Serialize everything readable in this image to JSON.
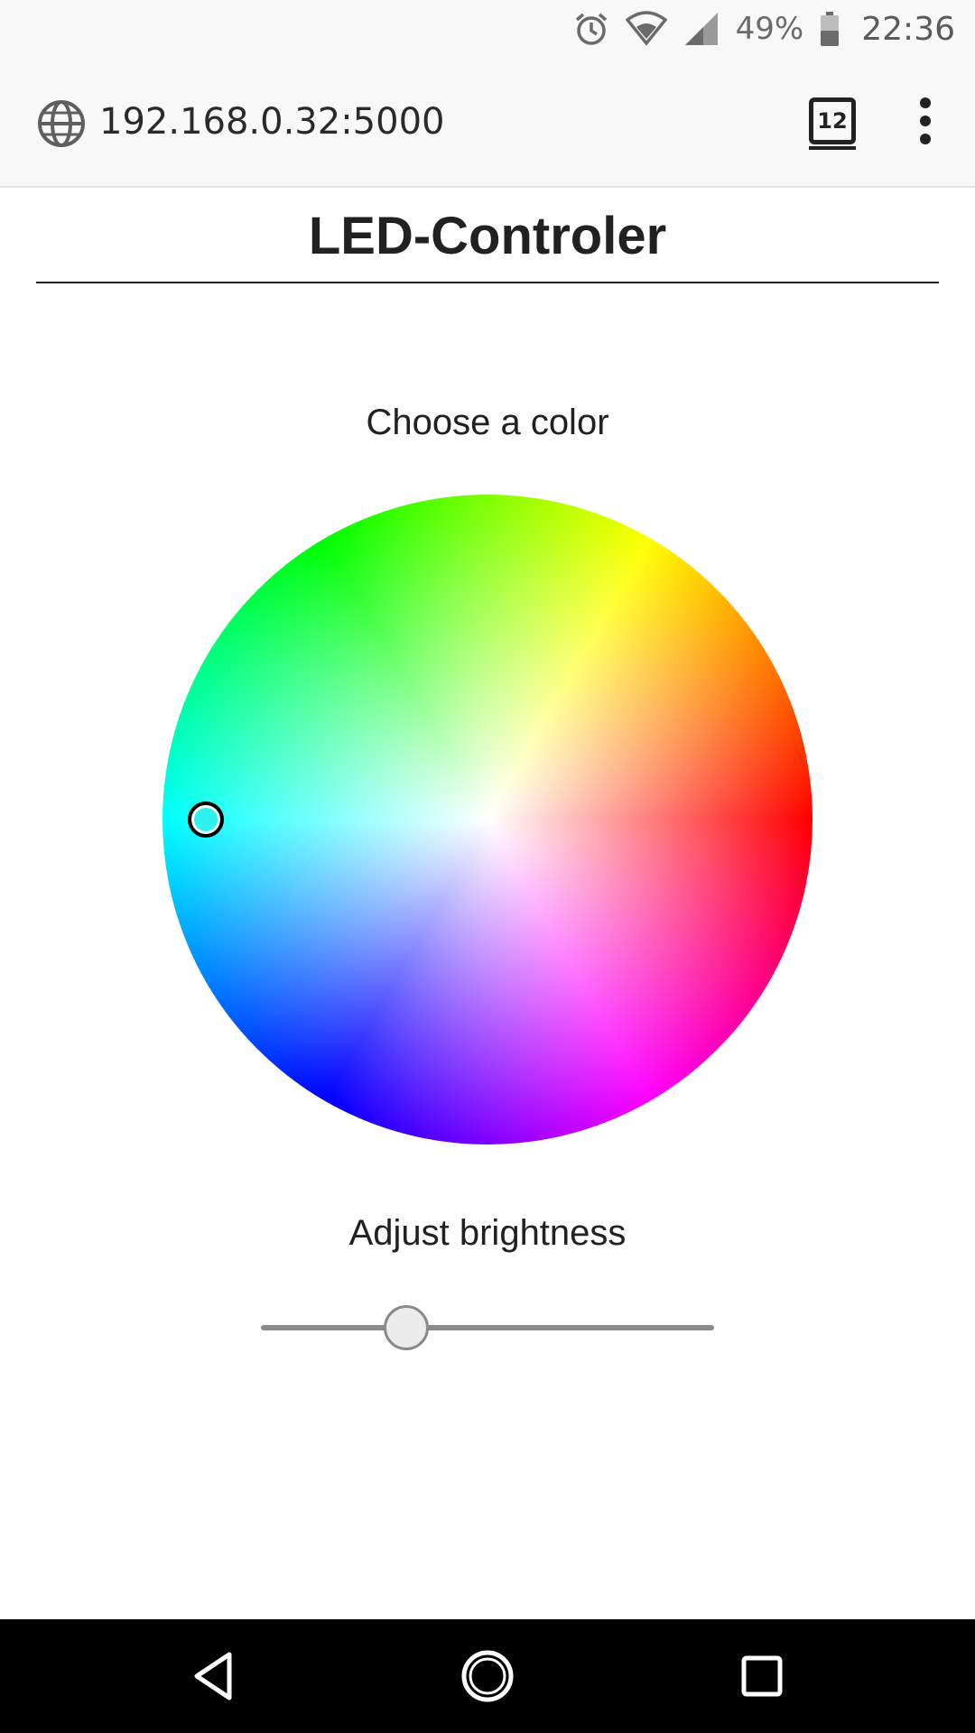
{
  "status_bar": {
    "battery_percent": "49%",
    "time": "22:36",
    "icons": [
      "alarm-icon",
      "wifi-icon",
      "signal-icon",
      "battery-icon"
    ]
  },
  "browser": {
    "url": "192.168.0.32:5000",
    "tab_count": "12",
    "icons": [
      "globe-icon",
      "tabs-icon",
      "more-vert-icon"
    ]
  },
  "page": {
    "title": "LED-Controler",
    "color_label": "Choose a color",
    "brightness_label": "Adjust brightness",
    "selected_color": "#2ef2ee",
    "brightness_fraction": 0.32
  },
  "nav_bar": {
    "icons": [
      "back-icon",
      "home-icon",
      "recents-icon"
    ]
  }
}
